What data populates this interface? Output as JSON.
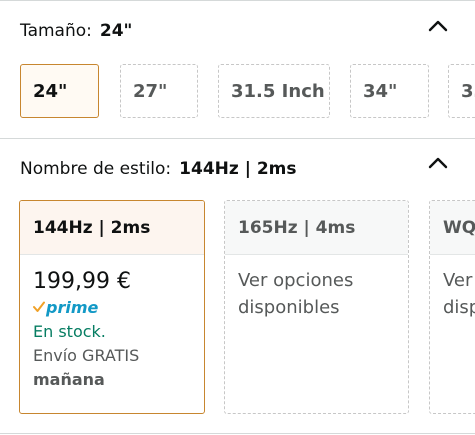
{
  "size_section": {
    "label": "Tamaño:",
    "value": "24\"",
    "options": [
      {
        "label": "24\"",
        "selected": true
      },
      {
        "label": "27\"",
        "selected": false
      },
      {
        "label": "31.5 Inch",
        "selected": false
      },
      {
        "label": "34\"",
        "selected": false
      },
      {
        "label": "3…",
        "selected": false
      }
    ]
  },
  "style_section": {
    "label": "Nombre de estilo:",
    "value": "144Hz | 2ms",
    "options": [
      {
        "label": "144Hz | 2ms",
        "selected": true,
        "price": "199,99 €",
        "prime": "prime",
        "stock": "En stock.",
        "shipping": "Envío GRATIS",
        "delivery": "mañana"
      },
      {
        "label": "165Hz | 4ms",
        "selected": false,
        "see_options_line1": "Ver opciones",
        "see_options_line2": "disponibles"
      },
      {
        "label": "WQ",
        "selected": false,
        "see_options_line1": "Ver",
        "see_options_line2": "disp"
      }
    ]
  },
  "icons": {
    "collapse": "chevron-up-icon",
    "prime_check": "check-icon"
  },
  "colors": {
    "selected_border": "#c7862f",
    "stock_green": "#067d62",
    "prime_blue": "#1399c6",
    "prime_check": "#f0a128"
  }
}
